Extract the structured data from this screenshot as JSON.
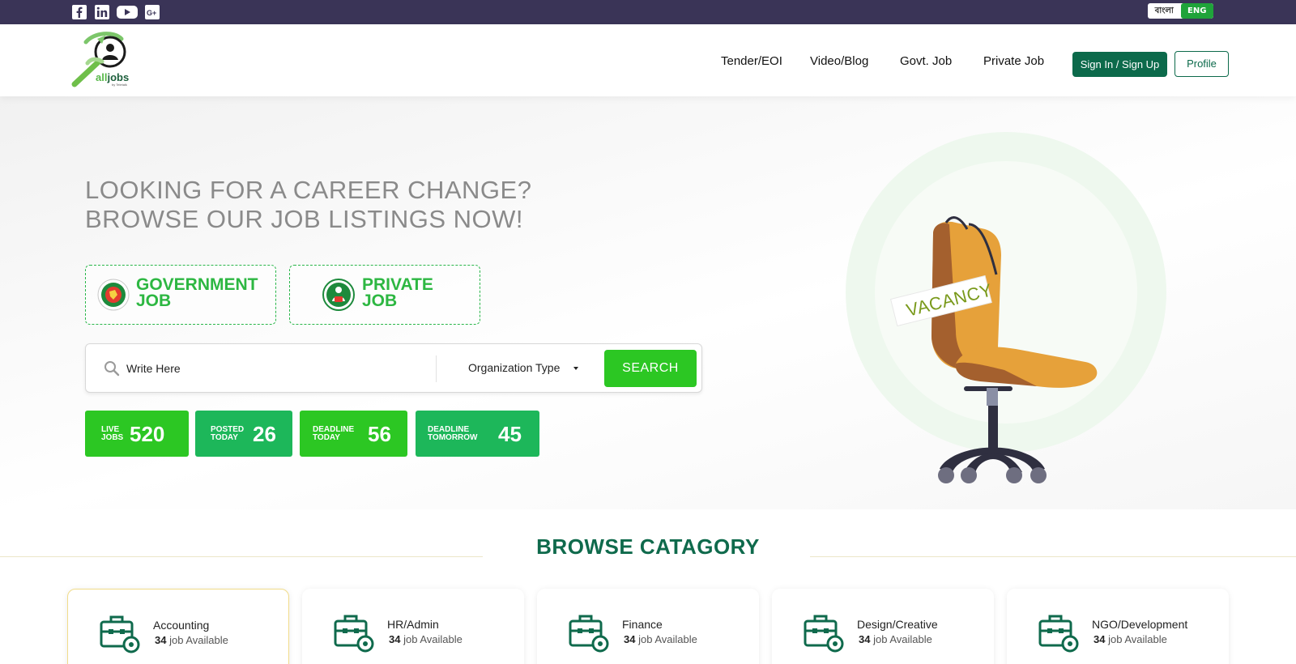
{
  "topbar": {
    "social": [
      "facebook-icon",
      "linkedin-icon",
      "youtube-icon",
      "google-plus-icon"
    ],
    "lang": {
      "bangla": "বাংলা",
      "english": "ENG"
    }
  },
  "header": {
    "logo": {
      "brand_prefix": "all",
      "brand_suffix": "jobs",
      "tagline": "by Teletalk"
    },
    "nav": [
      "Tender/EOI",
      "Video/Blog",
      "Govt. Job",
      "Private Job"
    ],
    "signin_label": "Sign In / Sign Up",
    "profile_label": "Profile"
  },
  "hero": {
    "headline_line1": "LOOKING FOR A CAREER CHANGE?",
    "headline_line2": "BROWSE OUR JOB LISTINGS NOW!",
    "job_types": [
      {
        "line1": "GOVERNMENT",
        "line2": "JOB"
      },
      {
        "line1": "PRIVATE",
        "line2": "JOB"
      }
    ],
    "search": {
      "placeholder": "Write Here",
      "org_type": "Organization Type",
      "button": "SEARCH"
    },
    "stats": [
      {
        "line1": "LIVE",
        "line2": "JOBS",
        "value": "520",
        "color": "#2cc723"
      },
      {
        "line1": "POSTED",
        "line2": "TODAY",
        "value": "26",
        "color": "#1db75a"
      },
      {
        "line1": "DEADLINE",
        "line2": "TODAY",
        "value": "56",
        "color": "#2cc723"
      },
      {
        "line1": "DEADLINE",
        "line2": "TOMORROW",
        "value": "45",
        "color": "#1db75a"
      }
    ],
    "illustration_sign": "VACANCY"
  },
  "browse": {
    "title": "BROWSE CATAGORY",
    "categories": [
      {
        "name": "Accounting",
        "count": "34",
        "suffix": "job Available"
      },
      {
        "name": "HR/Admin",
        "count": "34",
        "suffix": "job Available"
      },
      {
        "name": "Finance",
        "count": "34",
        "suffix": "job Available"
      },
      {
        "name": "Design/Creative",
        "count": "34",
        "suffix": "job Available"
      },
      {
        "name": "NGO/Development",
        "count": "34",
        "suffix": "job Available"
      }
    ]
  },
  "colors": {
    "brand_dark": "#0c6a4b",
    "accent_green": "#2cc723",
    "topbar": "#3a3457"
  }
}
